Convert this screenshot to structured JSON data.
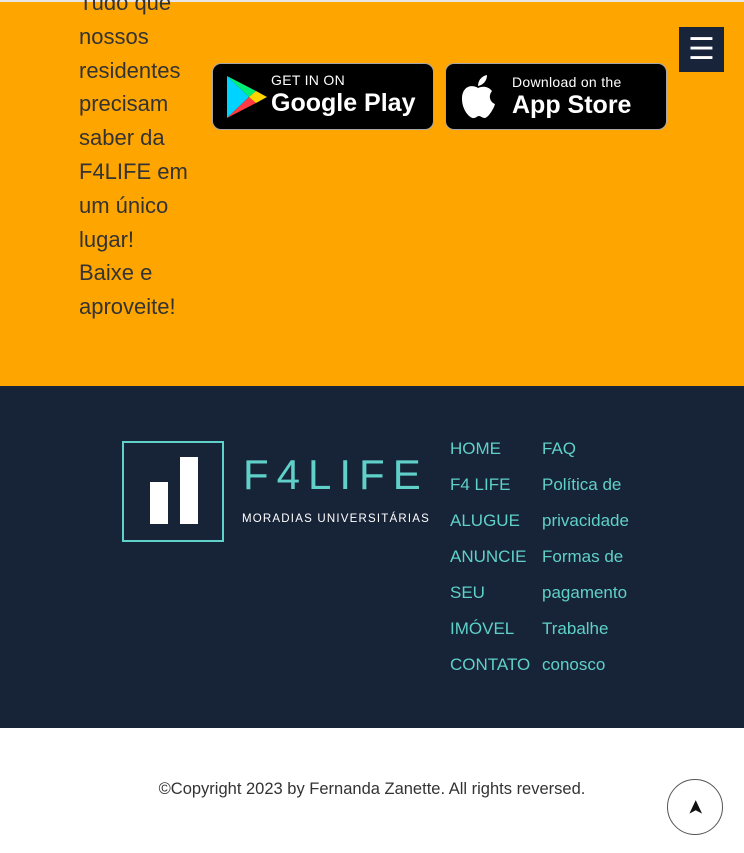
{
  "promo": {
    "lines": [
      "Tudo que",
      "nossos",
      "residentes",
      "precisam",
      "saber da",
      "F4LIFE em",
      "um único",
      "lugar!",
      "Baixe e",
      "aproveite!"
    ],
    "google_play": {
      "small": "GET IN ON",
      "big": "Google Play"
    },
    "app_store": {
      "small": "Download on the",
      "big": "App Store"
    }
  },
  "menu": {
    "icon": "hamburger-icon",
    "glyph": "☰"
  },
  "footer": {
    "logo": {
      "word": "F4LIFE",
      "tagline": "MORADIAS UNIVERSITÁRIAS"
    },
    "nav_col1": [
      "HOME",
      "F4 LIFE",
      "ALUGUE",
      "ANUNCIE",
      "SEU",
      "IMÓVEL",
      "CONTATO"
    ],
    "nav_col2": [
      "FAQ",
      "Política de",
      "privacidade",
      "Formas de",
      "pagamento",
      "Trabalhe",
      "conosco"
    ]
  },
  "copyright": "©Copyright 2023 by Fernanda Zanette. All rights reversed.",
  "back_to_top": {
    "icon": "arrow-up-icon",
    "glyph": "➤"
  },
  "colors": {
    "promo_bg": "#ffa500",
    "footer_bg": "#172337",
    "accent": "#5fd1c8",
    "menu_bg": "#17243a"
  }
}
